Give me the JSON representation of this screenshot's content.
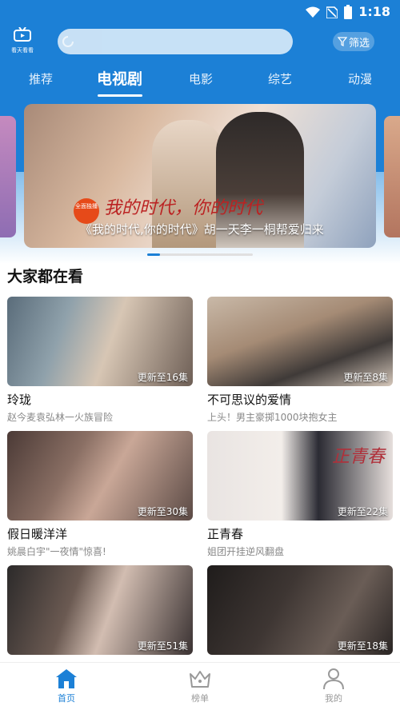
{
  "status": {
    "time": "1:18"
  },
  "app": {
    "logo_text": "看天看看"
  },
  "search": {
    "placeholder": ""
  },
  "filter": {
    "label": "筛选"
  },
  "tabs": [
    {
      "label": "推荐"
    },
    {
      "label": "电视剧"
    },
    {
      "label": "电影"
    },
    {
      "label": "综艺"
    },
    {
      "label": "动漫"
    }
  ],
  "active_tab": "电视剧",
  "banner": {
    "badge": "全面独播",
    "show_title": "我的时代，你的时代",
    "caption": "《我的时代,你的时代》胡一天李一桐帮爱归来",
    "page_index": 1
  },
  "section": {
    "title": "大家都在看"
  },
  "cards": [
    {
      "title": "玲珑",
      "subtitle": "赵今麦袁弘林一火族冒险",
      "badge": "更新至16集"
    },
    {
      "title": "不可思议的爱情",
      "subtitle": "上头！男主豪掷1000块抱女主",
      "badge": "更新至8集"
    },
    {
      "title": "假日暖洋洋",
      "subtitle": "姚晨白宇\"一夜情\"惊喜!",
      "badge": "更新至30集"
    },
    {
      "title": "正青春",
      "subtitle": "姐团开挂逆风翻盘",
      "badge": "更新至22集"
    },
    {
      "title": "",
      "subtitle": "",
      "badge": "更新至51集"
    },
    {
      "title": "",
      "subtitle": "",
      "badge": "更新至18集"
    }
  ],
  "card_image_tags": [
    "",
    "",
    "",
    "正青春",
    "",
    ""
  ],
  "bottom_nav": [
    {
      "label": "首页",
      "icon": "home-icon"
    },
    {
      "label": "榜单",
      "icon": "crown-icon"
    },
    {
      "label": "我的",
      "icon": "user-icon"
    }
  ],
  "colors": {
    "brand": "#1c80d6",
    "badge_text": "#ffffff"
  }
}
